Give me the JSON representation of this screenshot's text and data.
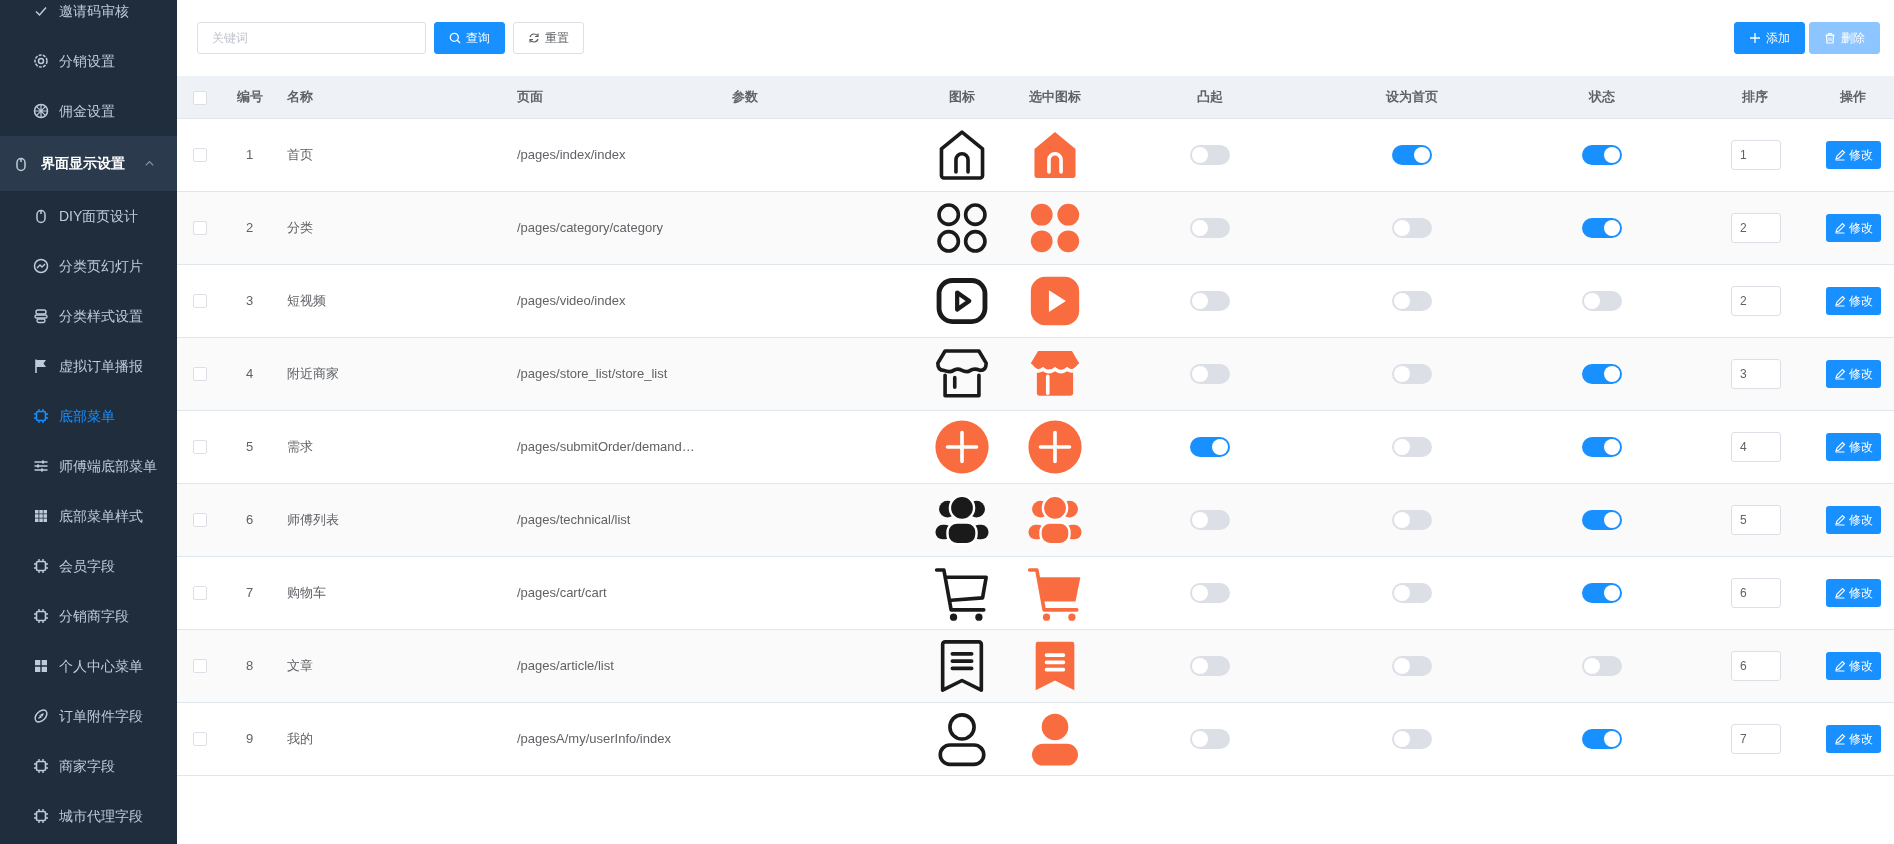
{
  "sidebar": {
    "items": [
      {
        "kind": "item",
        "label": "邀请码审核",
        "selected": false
      },
      {
        "kind": "item",
        "label": "分销设置",
        "selected": false
      },
      {
        "kind": "item",
        "label": "佣金设置",
        "selected": false
      },
      {
        "kind": "group",
        "label": "界面显示设置",
        "expanded": true,
        "children": [
          {
            "kind": "item",
            "label": "DIY面页设计",
            "selected": false
          },
          {
            "kind": "item",
            "label": "分类页幻灯片",
            "selected": false
          },
          {
            "kind": "item",
            "label": "分类样式设置",
            "selected": false
          },
          {
            "kind": "item",
            "label": "虚拟订单播报",
            "selected": false
          },
          {
            "kind": "item",
            "label": "底部菜单",
            "selected": true
          },
          {
            "kind": "item",
            "label": "师傅端底部菜单",
            "selected": false
          },
          {
            "kind": "item",
            "label": "底部菜单样式",
            "selected": false
          },
          {
            "kind": "item",
            "label": "会员字段",
            "selected": false
          },
          {
            "kind": "item",
            "label": "分销商字段",
            "selected": false
          },
          {
            "kind": "item",
            "label": "个人中心菜单",
            "selected": false
          },
          {
            "kind": "item",
            "label": "订单附件字段",
            "selected": false
          },
          {
            "kind": "item",
            "label": "商家字段",
            "selected": false
          },
          {
            "kind": "item",
            "label": "城市代理字段",
            "selected": false
          }
        ]
      }
    ]
  },
  "toolbar": {
    "search": {
      "placeholder": "关键词"
    },
    "buttons": [
      {
        "kind": "primary",
        "label": "查询"
      },
      {
        "kind": "default",
        "label": "重置"
      }
    ],
    "actions": [
      {
        "kind": "add",
        "label": "添加",
        "disabled": false
      },
      {
        "kind": "delete",
        "label": "删除",
        "disabled": true
      }
    ]
  },
  "table": {
    "all_checked": false,
    "columns": [
      "编号",
      "名称",
      "页面",
      "参数",
      "图标",
      "选中图标",
      "凸起",
      "设为首页",
      "状态",
      "排序",
      "操作"
    ],
    "rows": [
      {
        "checked": false,
        "id": "1",
        "name": "首页",
        "page": "/pages/index/index",
        "raised": false,
        "home": true,
        "status": true,
        "sort": "1",
        "action": "修改"
      },
      {
        "checked": false,
        "id": "2",
        "name": "分类",
        "page": "/pages/category/category",
        "raised": false,
        "home": false,
        "status": true,
        "sort": "2",
        "action": "修改"
      },
      {
        "checked": false,
        "id": "3",
        "name": "短视频",
        "page": "/pages/video/index",
        "raised": false,
        "home": false,
        "status": false,
        "sort": "2",
        "action": "修改"
      },
      {
        "checked": false,
        "id": "4",
        "name": "附近商家",
        "page": "/pages/store_list/store_list",
        "raised": false,
        "home": false,
        "status": true,
        "sort": "3",
        "action": "修改"
      },
      {
        "checked": false,
        "id": "5",
        "name": "需求",
        "page": "/pages/submitOrder/demand…",
        "raised": true,
        "home": false,
        "status": true,
        "sort": "4",
        "action": "修改"
      },
      {
        "checked": false,
        "id": "6",
        "name": "师傅列表",
        "page": "/pages/technical/list",
        "raised": false,
        "home": false,
        "status": true,
        "sort": "5",
        "action": "修改"
      },
      {
        "checked": false,
        "id": "7",
        "name": "购物车",
        "page": "/pages/cart/cart",
        "raised": false,
        "home": false,
        "status": true,
        "sort": "6",
        "action": "修改"
      },
      {
        "checked": false,
        "id": "8",
        "name": "文章",
        "page": "/pages/article/list",
        "raised": false,
        "home": false,
        "status": false,
        "sort": "6",
        "action": "修改"
      },
      {
        "checked": false,
        "id": "9",
        "name": "我的",
        "page": "/pagesA/my/userInfo/index",
        "raised": false,
        "home": false,
        "status": true,
        "sort": "7",
        "action": "修改"
      }
    ]
  }
}
